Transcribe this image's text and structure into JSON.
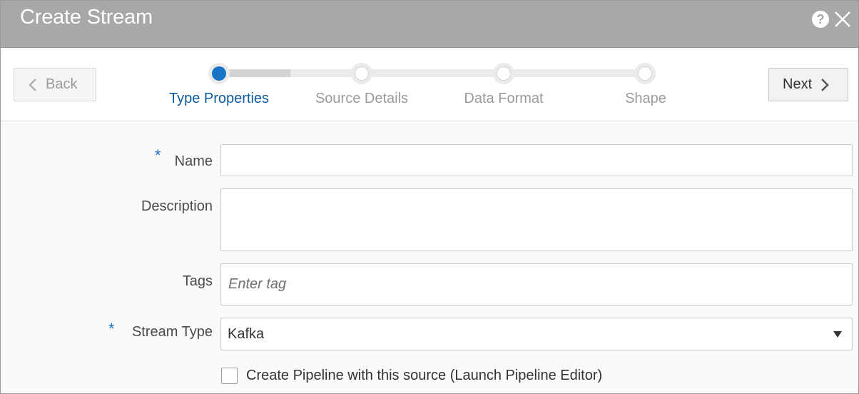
{
  "dialog": {
    "title": "Create Stream",
    "help_icon": "help-icon",
    "close_icon": "close-icon"
  },
  "wizard": {
    "back_label": "Back",
    "next_label": "Next",
    "current_step": 1,
    "steps": [
      {
        "label": "Type Properties",
        "state": "active"
      },
      {
        "label": "Source Details",
        "state": "todo"
      },
      {
        "label": "Data Format",
        "state": "todo"
      },
      {
        "label": "Shape",
        "state": "todo"
      }
    ]
  },
  "form": {
    "required_mark": "*",
    "name": {
      "label": "Name",
      "value": "",
      "required": true
    },
    "description": {
      "label": "Description",
      "value": ""
    },
    "tags": {
      "label": "Tags",
      "value": "",
      "placeholder": "Enter tag"
    },
    "stream_type": {
      "label": "Stream Type",
      "value": "Kafka",
      "required": true
    },
    "create_pipeline": {
      "label": "Create Pipeline with this source (Launch Pipeline Editor)",
      "checked": false
    }
  },
  "colors": {
    "title_bar": "#a8a8a8",
    "accent": "#1a73c7",
    "active_step_text": "#0b5a9e"
  }
}
